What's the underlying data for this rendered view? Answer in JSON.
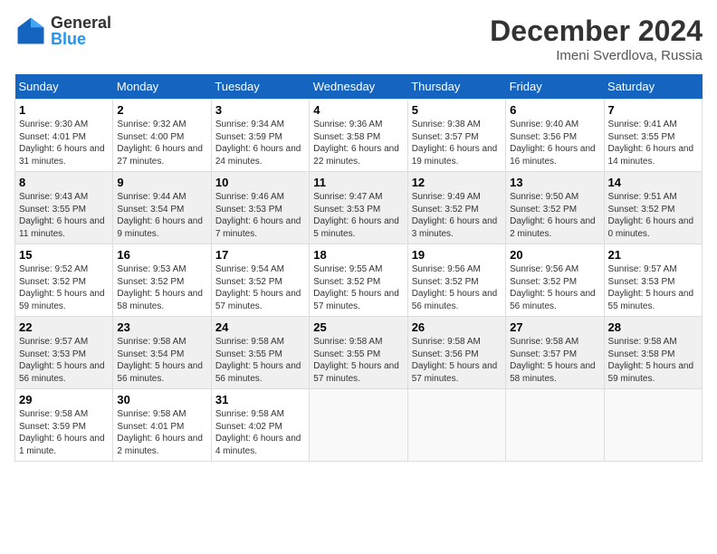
{
  "header": {
    "logo_line1": "General",
    "logo_line2": "Blue",
    "month": "December 2024",
    "location": "Imeni Sverdlova, Russia"
  },
  "weekdays": [
    "Sunday",
    "Monday",
    "Tuesday",
    "Wednesday",
    "Thursday",
    "Friday",
    "Saturday"
  ],
  "weeks": [
    [
      {
        "day": "1",
        "info": "Sunrise: 9:30 AM\nSunset: 4:01 PM\nDaylight: 6 hours and 31 minutes."
      },
      {
        "day": "2",
        "info": "Sunrise: 9:32 AM\nSunset: 4:00 PM\nDaylight: 6 hours and 27 minutes."
      },
      {
        "day": "3",
        "info": "Sunrise: 9:34 AM\nSunset: 3:59 PM\nDaylight: 6 hours and 24 minutes."
      },
      {
        "day": "4",
        "info": "Sunrise: 9:36 AM\nSunset: 3:58 PM\nDaylight: 6 hours and 22 minutes."
      },
      {
        "day": "5",
        "info": "Sunrise: 9:38 AM\nSunset: 3:57 PM\nDaylight: 6 hours and 19 minutes."
      },
      {
        "day": "6",
        "info": "Sunrise: 9:40 AM\nSunset: 3:56 PM\nDaylight: 6 hours and 16 minutes."
      },
      {
        "day": "7",
        "info": "Sunrise: 9:41 AM\nSunset: 3:55 PM\nDaylight: 6 hours and 14 minutes."
      }
    ],
    [
      {
        "day": "8",
        "info": "Sunrise: 9:43 AM\nSunset: 3:55 PM\nDaylight: 6 hours and 11 minutes."
      },
      {
        "day": "9",
        "info": "Sunrise: 9:44 AM\nSunset: 3:54 PM\nDaylight: 6 hours and 9 minutes."
      },
      {
        "day": "10",
        "info": "Sunrise: 9:46 AM\nSunset: 3:53 PM\nDaylight: 6 hours and 7 minutes."
      },
      {
        "day": "11",
        "info": "Sunrise: 9:47 AM\nSunset: 3:53 PM\nDaylight: 6 hours and 5 minutes."
      },
      {
        "day": "12",
        "info": "Sunrise: 9:49 AM\nSunset: 3:52 PM\nDaylight: 6 hours and 3 minutes."
      },
      {
        "day": "13",
        "info": "Sunrise: 9:50 AM\nSunset: 3:52 PM\nDaylight: 6 hours and 2 minutes."
      },
      {
        "day": "14",
        "info": "Sunrise: 9:51 AM\nSunset: 3:52 PM\nDaylight: 6 hours and 0 minutes."
      }
    ],
    [
      {
        "day": "15",
        "info": "Sunrise: 9:52 AM\nSunset: 3:52 PM\nDaylight: 5 hours and 59 minutes."
      },
      {
        "day": "16",
        "info": "Sunrise: 9:53 AM\nSunset: 3:52 PM\nDaylight: 5 hours and 58 minutes."
      },
      {
        "day": "17",
        "info": "Sunrise: 9:54 AM\nSunset: 3:52 PM\nDaylight: 5 hours and 57 minutes."
      },
      {
        "day": "18",
        "info": "Sunrise: 9:55 AM\nSunset: 3:52 PM\nDaylight: 5 hours and 57 minutes."
      },
      {
        "day": "19",
        "info": "Sunrise: 9:56 AM\nSunset: 3:52 PM\nDaylight: 5 hours and 56 minutes."
      },
      {
        "day": "20",
        "info": "Sunrise: 9:56 AM\nSunset: 3:52 PM\nDaylight: 5 hours and 56 minutes."
      },
      {
        "day": "21",
        "info": "Sunrise: 9:57 AM\nSunset: 3:53 PM\nDaylight: 5 hours and 55 minutes."
      }
    ],
    [
      {
        "day": "22",
        "info": "Sunrise: 9:57 AM\nSunset: 3:53 PM\nDaylight: 5 hours and 56 minutes."
      },
      {
        "day": "23",
        "info": "Sunrise: 9:58 AM\nSunset: 3:54 PM\nDaylight: 5 hours and 56 minutes."
      },
      {
        "day": "24",
        "info": "Sunrise: 9:58 AM\nSunset: 3:55 PM\nDaylight: 5 hours and 56 minutes."
      },
      {
        "day": "25",
        "info": "Sunrise: 9:58 AM\nSunset: 3:55 PM\nDaylight: 5 hours and 57 minutes."
      },
      {
        "day": "26",
        "info": "Sunrise: 9:58 AM\nSunset: 3:56 PM\nDaylight: 5 hours and 57 minutes."
      },
      {
        "day": "27",
        "info": "Sunrise: 9:58 AM\nSunset: 3:57 PM\nDaylight: 5 hours and 58 minutes."
      },
      {
        "day": "28",
        "info": "Sunrise: 9:58 AM\nSunset: 3:58 PM\nDaylight: 5 hours and 59 minutes."
      }
    ],
    [
      {
        "day": "29",
        "info": "Sunrise: 9:58 AM\nSunset: 3:59 PM\nDaylight: 6 hours and 1 minute."
      },
      {
        "day": "30",
        "info": "Sunrise: 9:58 AM\nSunset: 4:01 PM\nDaylight: 6 hours and 2 minutes."
      },
      {
        "day": "31",
        "info": "Sunrise: 9:58 AM\nSunset: 4:02 PM\nDaylight: 6 hours and 4 minutes."
      },
      null,
      null,
      null,
      null
    ]
  ]
}
